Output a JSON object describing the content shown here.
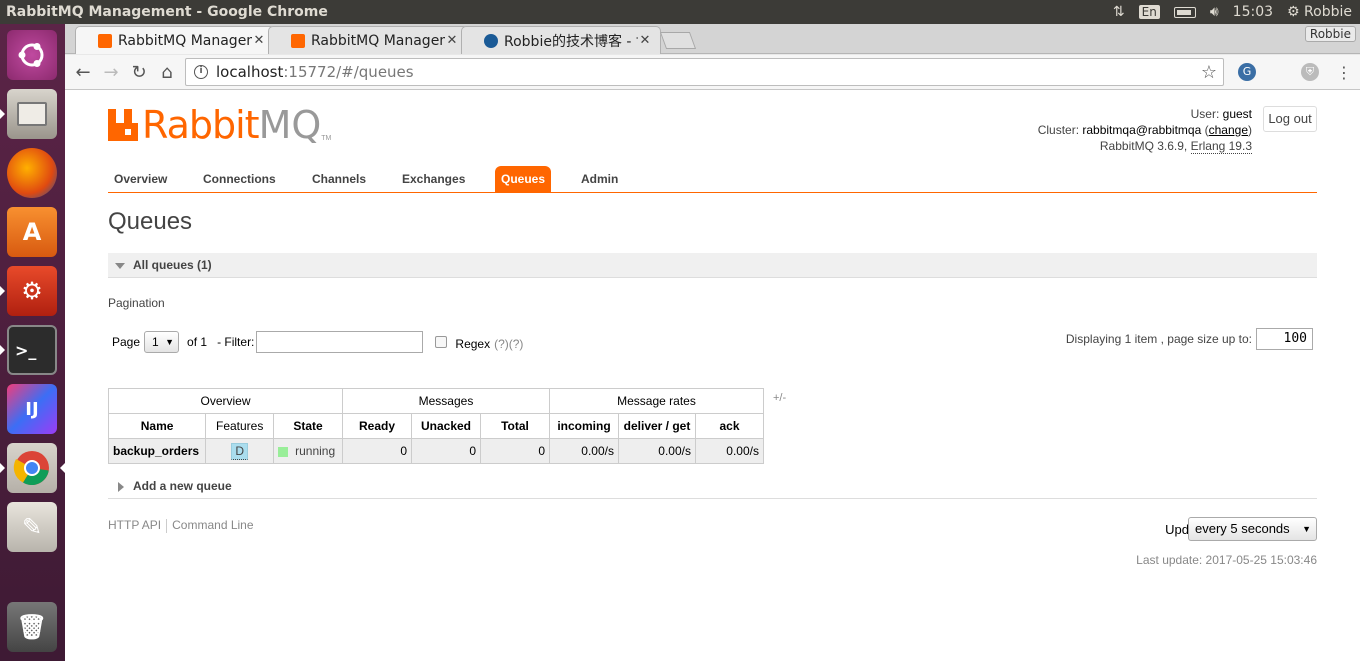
{
  "top_panel": {
    "title": "RabbitMQ Management - Google Chrome",
    "lang": "En",
    "time": "15:03",
    "user": "Robbie"
  },
  "launcher": {
    "items": [
      "ubuntu-dash-icon",
      "files-icon",
      "firefox-icon",
      "software-center-icon",
      "system-settings-icon",
      "terminal-icon",
      "intellij-icon",
      "chrome-icon",
      "text-editor-icon",
      "trash-icon"
    ]
  },
  "browser": {
    "tabs": [
      {
        "label": "RabbitMQ Management"
      },
      {
        "label": "RabbitMQ Management"
      },
      {
        "label": "Robbie的技术博客 - 博客"
      }
    ],
    "profile": "Robbie",
    "url_host": "localhost",
    "url_path": ":15772/#/queues"
  },
  "header": {
    "logo_rabbit": "Rabbit",
    "logo_mq": "MQ",
    "logo_tm": "TM",
    "user_label": "User:",
    "user_value": "guest",
    "cluster_label": "Cluster:",
    "cluster_value": "rabbitmqa@rabbitmqa",
    "cluster_change": "change",
    "version": "RabbitMQ 3.6.9,",
    "erlang": "Erlang 19.3",
    "logout": "Log out"
  },
  "menu": {
    "items": [
      "Overview",
      "Connections",
      "Channels",
      "Exchanges",
      "Queues",
      "Admin"
    ],
    "active": "Queues"
  },
  "page": {
    "title": "Queues",
    "section": "All queues (1)",
    "pagination_label": "Pagination",
    "page_label": "Page",
    "page_value": "1",
    "of_label": "of 1",
    "filter_label": "- Filter:",
    "regex_label": "Regex",
    "regex_help": "(?)(?)",
    "display_text": "Displaying 1 item , page size up to:",
    "page_size": "100",
    "plus_minus": "+/-",
    "add_queue": "Add a new queue"
  },
  "table": {
    "groups": [
      "Overview",
      "Messages",
      "Message rates"
    ],
    "columns": [
      "Name",
      "Features",
      "State",
      "Ready",
      "Unacked",
      "Total",
      "incoming",
      "deliver / get",
      "ack"
    ],
    "rows": [
      {
        "name": "backup_orders",
        "features": "D",
        "state": "running",
        "ready": "0",
        "unacked": "0",
        "total": "0",
        "incoming": "0.00/s",
        "deliver_get": "0.00/s",
        "ack": "0.00/s"
      }
    ]
  },
  "footer": {
    "http_api": "HTTP API",
    "command_line": "Command Line",
    "update_label": "Update",
    "update_value": "every 5 seconds",
    "last_update": "Last update: 2017-05-25 15:03:46"
  },
  "colors": {
    "accent": "#ff6600",
    "launcher": "#5b2447",
    "panel": "#3c3b37"
  }
}
